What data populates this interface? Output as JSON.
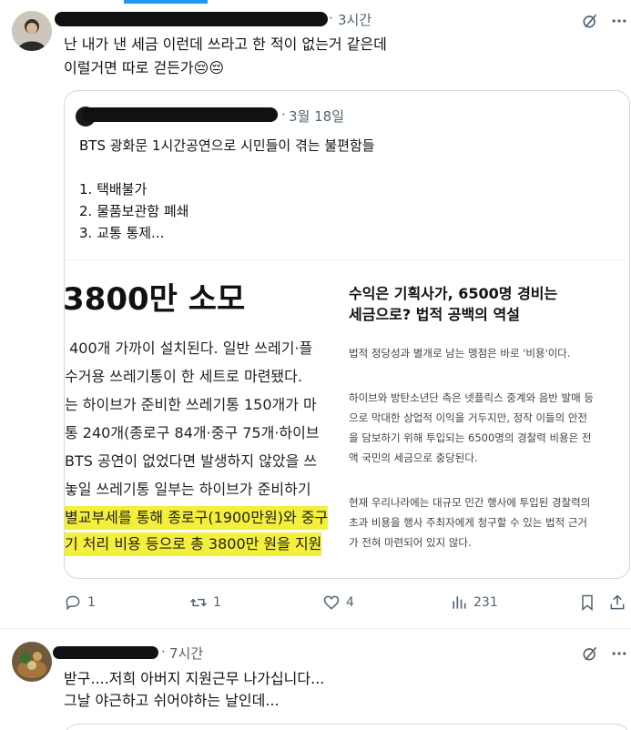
{
  "top_bar_color": "#1d9bf0",
  "post1": {
    "time": "3시간",
    "text_lines": [
      "난 내가 낸 세금 이런데 쓰라고 한 적이 없는거 같은데",
      "이럴거면 따로 걷든가😔😔"
    ],
    "icons": [
      "grok-icon",
      "more-icon"
    ],
    "quote": {
      "time": "3월 18일",
      "title": "BTS 광화문 1시간공연으로 시민들이 겪는 불편함들",
      "items": [
        "1. 택배불가",
        "2. 물품보관함 폐쇄",
        "3. 교통 통제..."
      ],
      "image": {
        "left_headline": "3800만 소모",
        "left_lines": [
          " 400개 가까이 설치된다. 일반 쓰레기·플",
          "수거용 쓰레기통이 한 세트로 마련됐다.",
          "는 하이브가 준비한 쓰레기통 150개가 마",
          "통 240개(종로구 84개·중구 75개·하이브",
          "BTS 공연이 없었다면 발생하지 않았을 쓰",
          "놓일 쓰레기통 일부는 하이브가 준비하기",
          "별교부세를 통해 종로구(1900만원)와 중구",
          "기 처리 비용 등으로 총 3800만 원을 지원"
        ],
        "right_headline": [
          "수익은 기획사가, 6500명 경비는",
          "세금으로? 법적 공백의 역설"
        ],
        "right_paragraphs": [
          [
            "법적 정당성과 별개로 남는 맹점은 바로 '비용'이다."
          ],
          [
            "하이브와 방탄소년단 측은 넷플릭스 중계와 음반 발매 등",
            "으로 막대한 상업적 이익을 거두지만, 정작 이들의 안전",
            "을 담보하기 위해 투입되는 6500명의 경찰력 비용은 전",
            "액 국민의 세금으로 충당된다."
          ],
          [
            "현재 우리나라에는 대규모 민간 행사에 투입된 경찰력의",
            "초과 비용을 행사 주최자에게 청구할 수 있는 법적 근거",
            "가 전혀 마련되어 있지 않다."
          ]
        ]
      }
    },
    "actions": {
      "reply": "1",
      "retweet": "1",
      "like": "4",
      "views": "231"
    }
  },
  "post2": {
    "time": "7시간",
    "text_lines": [
      "받구....저희 아버지 지원근무 나가십니다...",
      "그날 야근하고 쉬어야하는 날인데..."
    ]
  }
}
